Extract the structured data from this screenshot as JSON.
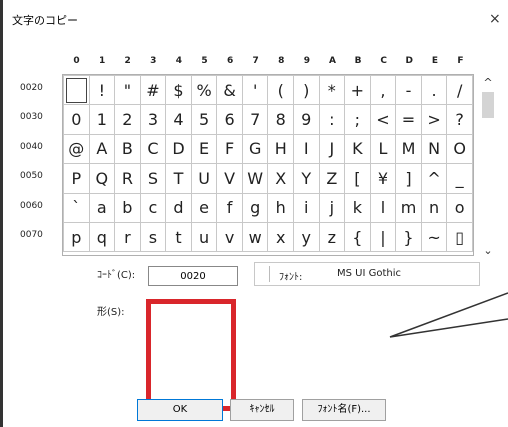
{
  "window": {
    "title": "文字のコピー",
    "close_label": "×"
  },
  "columns": [
    "0",
    "1",
    "2",
    "3",
    "4",
    "5",
    "6",
    "7",
    "8",
    "9",
    "A",
    "B",
    "C",
    "D",
    "E",
    "F"
  ],
  "rows": [
    {
      "label": "0020",
      "chars": [
        " ",
        "!",
        "\"",
        "#",
        "$",
        "%",
        "&",
        "'",
        "(",
        ")",
        "*",
        "+",
        ",",
        "-",
        ".",
        "/"
      ]
    },
    {
      "label": "0030",
      "chars": [
        "0",
        "1",
        "2",
        "3",
        "4",
        "5",
        "6",
        "7",
        "8",
        "9",
        ":",
        ";",
        "<",
        "=",
        ">",
        "?"
      ]
    },
    {
      "label": "0040",
      "chars": [
        "@",
        "A",
        "B",
        "C",
        "D",
        "E",
        "F",
        "G",
        "H",
        "I",
        "J",
        "K",
        "L",
        "M",
        "N",
        "O"
      ]
    },
    {
      "label": "0050",
      "chars": [
        "P",
        "Q",
        "R",
        "S",
        "T",
        "U",
        "V",
        "W",
        "X",
        "Y",
        "Z",
        "[",
        "¥",
        "]",
        "^",
        "_"
      ]
    },
    {
      "label": "0060",
      "chars": [
        "`",
        "a",
        "b",
        "c",
        "d",
        "e",
        "f",
        "g",
        "h",
        "i",
        "j",
        "k",
        "l",
        "m",
        "n",
        "o"
      ]
    },
    {
      "label": "0070",
      "chars": [
        "p",
        "q",
        "r",
        "s",
        "t",
        "u",
        "v",
        "w",
        "x",
        "y",
        "z",
        "{",
        "|",
        "}",
        "~",
        "▯"
      ]
    }
  ],
  "selected_cell": {
    "row": 0,
    "col": 0
  },
  "scrollbar": {
    "up_arrow": "^",
    "down_arrow": "⌄"
  },
  "code": {
    "label": "ｺｰﾄﾞ(C):",
    "value": "0020"
  },
  "font": {
    "label": "ﾌｫﾝﾄ:",
    "value": "MS UI Gothic"
  },
  "shape": {
    "label": "形(S):"
  },
  "buttons": {
    "ok": "OK",
    "cancel": "ｷｬﾝｾﾙ",
    "font_name": "ﾌｫﾝﾄ名(F)..."
  }
}
